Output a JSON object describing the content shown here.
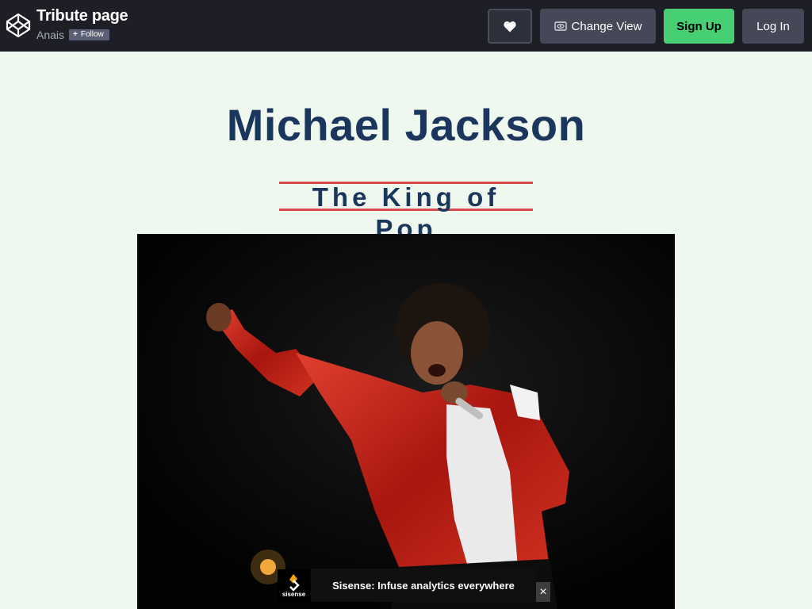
{
  "header": {
    "title": "Tribute page",
    "author": "Anais",
    "follow_label": "Follow",
    "change_view_label": "Change View",
    "signup_label": "Sign Up",
    "login_label": "Log In",
    "icons": [
      "codepen-logo-icon",
      "plus-icon",
      "heart-icon",
      "eye-icon"
    ]
  },
  "page": {
    "title": "Michael Jackson",
    "subtitle": "The King of Pop",
    "image_subject": "Michael Jackson performing in red jacket"
  },
  "ad": {
    "brand": "sisense",
    "text": "Sisense: Infuse analytics everywhere",
    "close_label": "×"
  },
  "colors": {
    "topbar_bg": "#1e1f26",
    "page_bg": "#eff8ee",
    "title_color": "#1b365d",
    "subtitle_border": "#d8494e",
    "signup_green": "#47cf73"
  }
}
